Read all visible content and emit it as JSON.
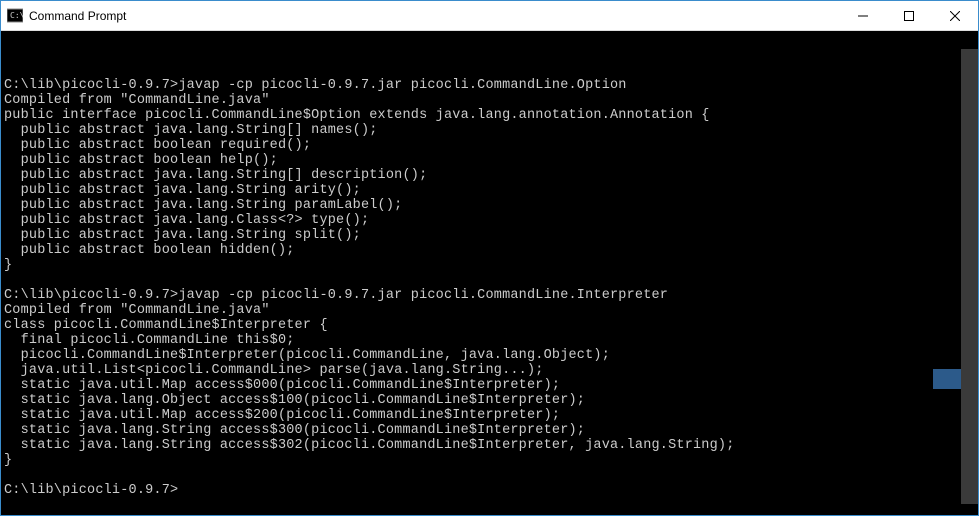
{
  "window": {
    "title": "Command Prompt"
  },
  "terminal": {
    "lines": [
      "",
      "C:\\lib\\picocli-0.9.7>javap -cp picocli-0.9.7.jar picocli.CommandLine.Option",
      "Compiled from \"CommandLine.java\"",
      "public interface picocli.CommandLine$Option extends java.lang.annotation.Annotation {",
      "  public abstract java.lang.String[] names();",
      "  public abstract boolean required();",
      "  public abstract boolean help();",
      "  public abstract java.lang.String[] description();",
      "  public abstract java.lang.String arity();",
      "  public abstract java.lang.String paramLabel();",
      "  public abstract java.lang.Class<?> type();",
      "  public abstract java.lang.String split();",
      "  public abstract boolean hidden();",
      "}",
      "",
      "C:\\lib\\picocli-0.9.7>javap -cp picocli-0.9.7.jar picocli.CommandLine.Interpreter",
      "Compiled from \"CommandLine.java\"",
      "class picocli.CommandLine$Interpreter {",
      "  final picocli.CommandLine this$0;",
      "  picocli.CommandLine$Interpreter(picocli.CommandLine, java.lang.Object);",
      "  java.util.List<picocli.CommandLine> parse(java.lang.String...);",
      "  static java.util.Map access$000(picocli.CommandLine$Interpreter);",
      "  static java.lang.Object access$100(picocli.CommandLine$Interpreter);",
      "  static java.util.Map access$200(picocli.CommandLine$Interpreter);",
      "  static java.lang.String access$300(picocli.CommandLine$Interpreter);",
      "  static java.lang.String access$302(picocli.CommandLine$Interpreter, java.lang.String);",
      "}",
      "",
      "C:\\lib\\picocli-0.9.7>"
    ]
  }
}
